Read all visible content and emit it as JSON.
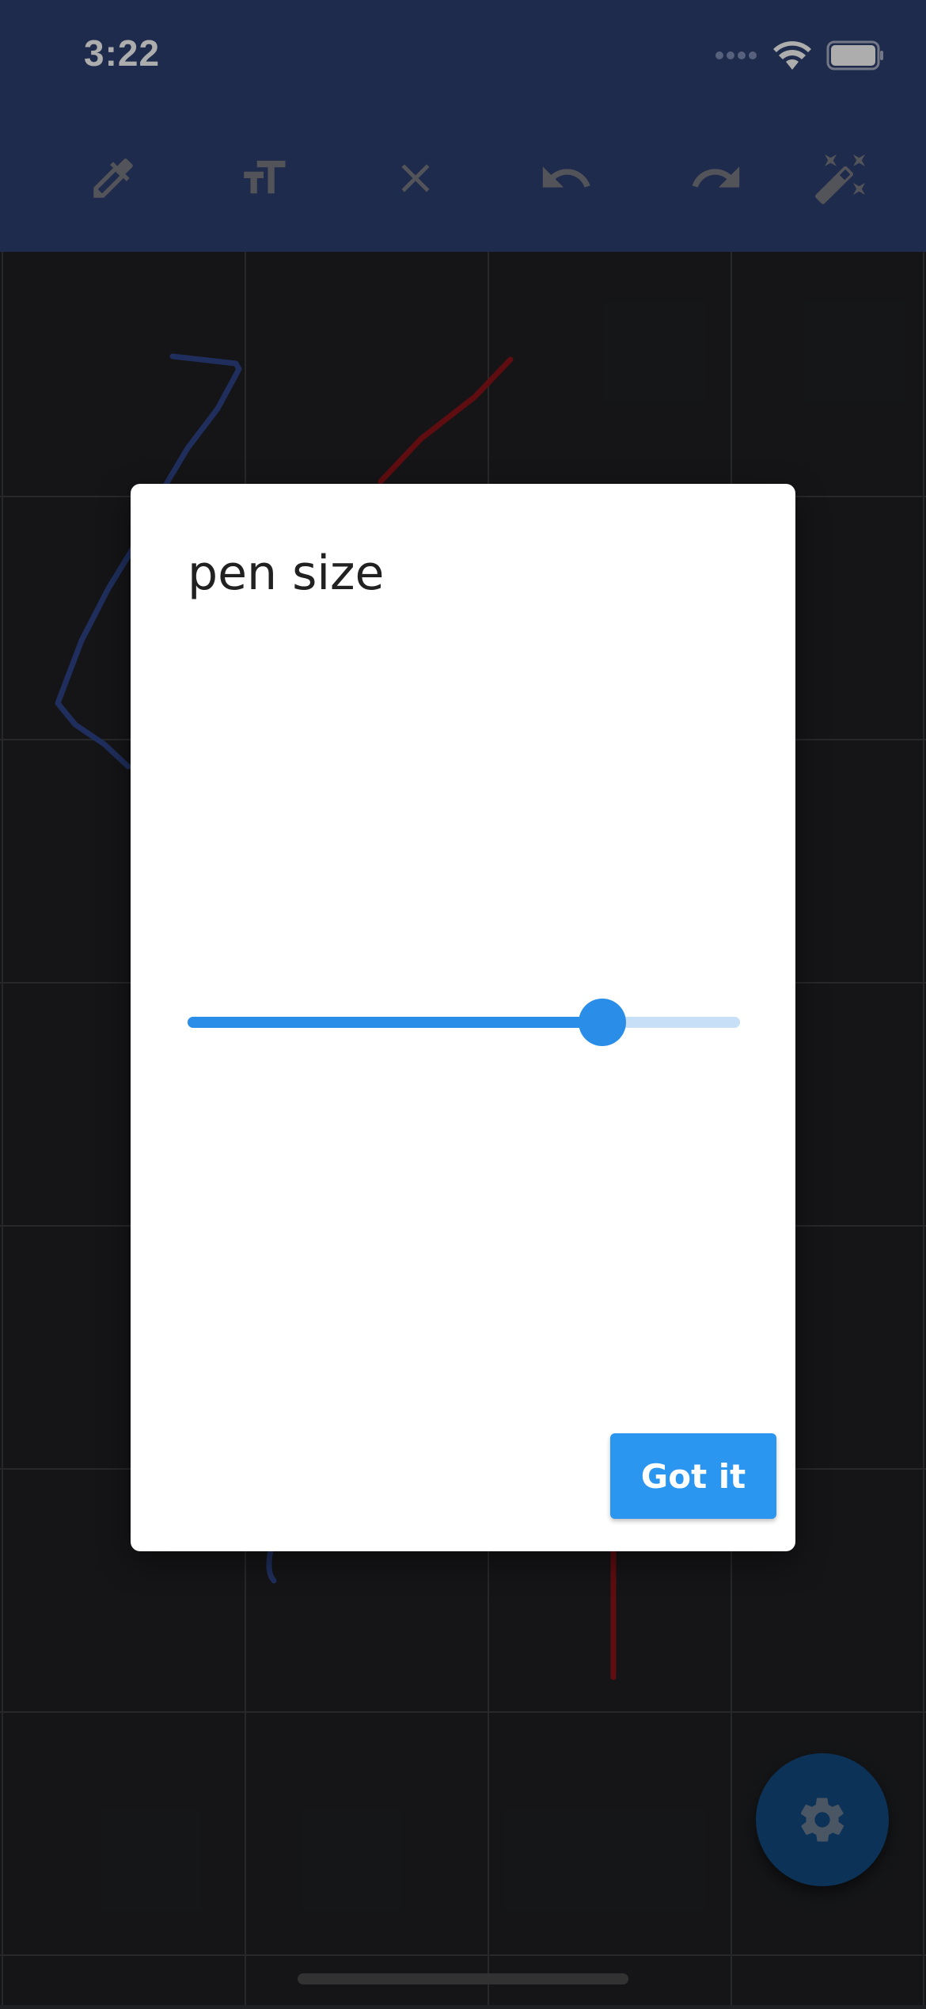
{
  "status_bar": {
    "time": "3:22",
    "icons": [
      "cellular-dots-icon",
      "wifi-icon",
      "battery-icon"
    ]
  },
  "toolbar": {
    "items": [
      {
        "icon": "eyedropper-icon"
      },
      {
        "icon": "text-size-icon"
      },
      {
        "icon": "close-icon"
      },
      {
        "icon": "undo-icon"
      },
      {
        "icon": "redo-icon"
      },
      {
        "icon": "magic-wand-icon"
      }
    ]
  },
  "colors": {
    "appbar": "#2e4070",
    "canvas": "#1f2023",
    "grid": "#3a3b3e",
    "accent": "#2a8ee8",
    "stroke_blue": "#2f4588",
    "stroke_red": "#8c1418",
    "fab": "#124a80"
  },
  "dialog": {
    "title": "pen size",
    "slider_value": 0.75,
    "confirm_label": "Got it"
  },
  "fab": {
    "icon": "gear-icon"
  }
}
